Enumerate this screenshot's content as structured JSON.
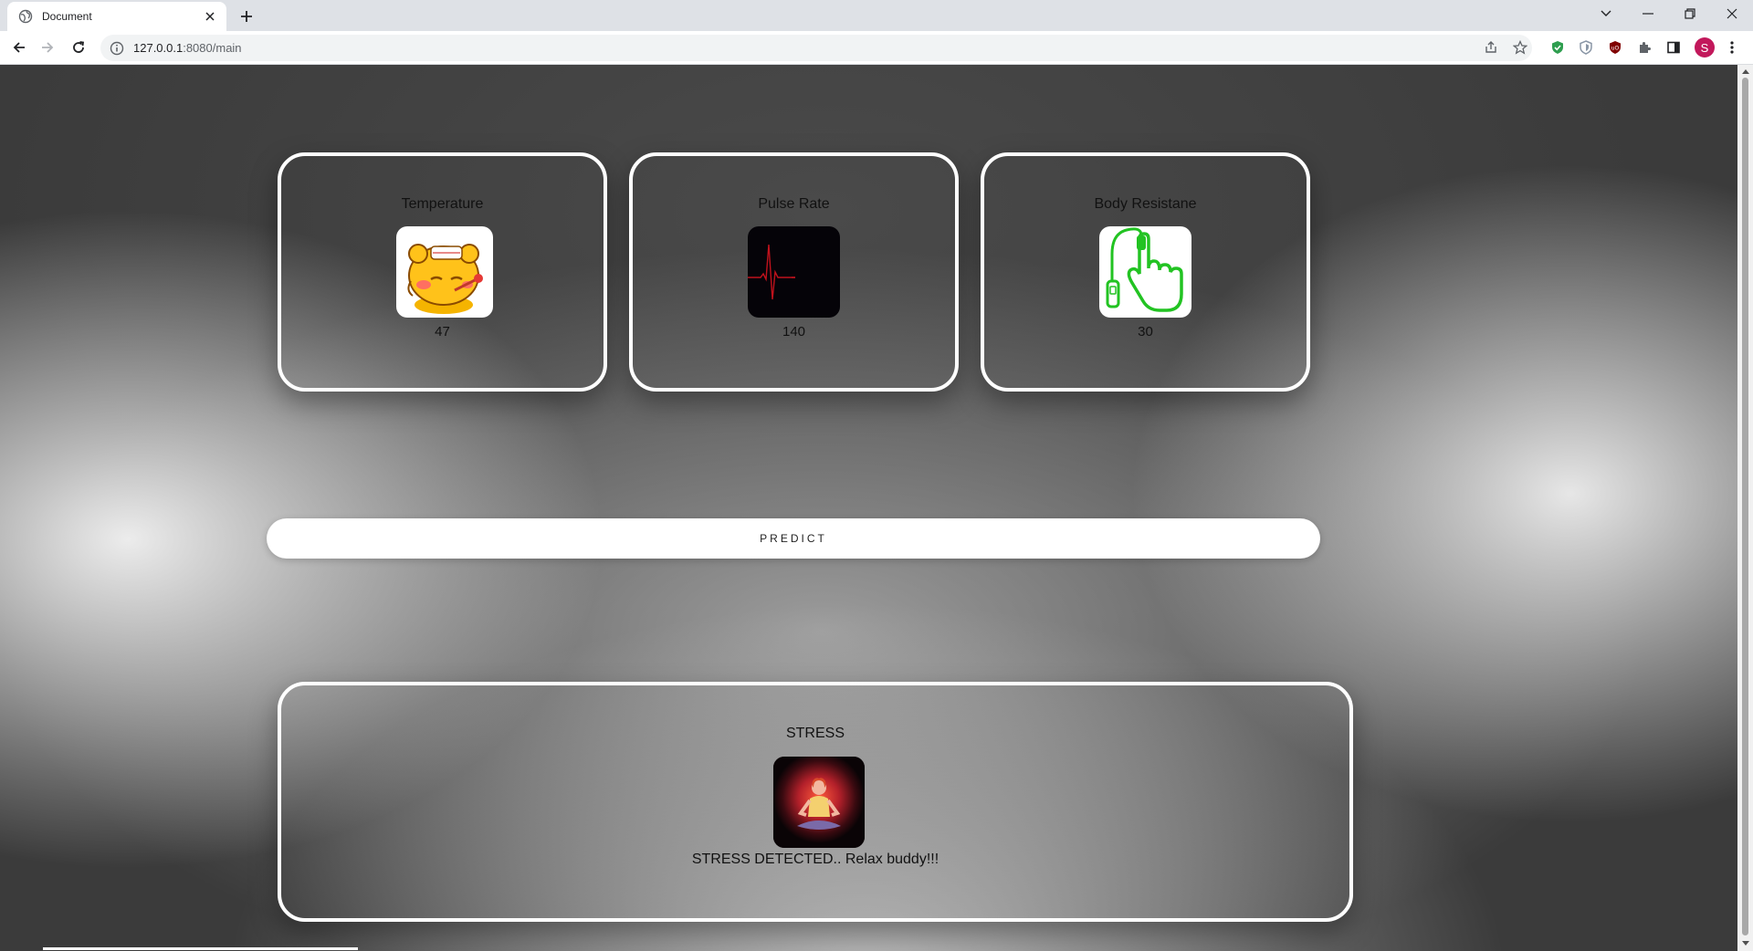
{
  "browser": {
    "tab_title": "Document",
    "url_host": "127.0.0.1",
    "url_path": ":8080/main",
    "avatar_letter": "S"
  },
  "cards": {
    "temperature": {
      "label": "Temperature",
      "value": "47",
      "icon": "sick-bear-thermometer-icon"
    },
    "pulse": {
      "label": "Pulse Rate",
      "value": "140",
      "icon": "heartbeat-ecg-icon"
    },
    "resistance": {
      "label": "Body Resistane",
      "value": "30",
      "icon": "finger-sensor-icon"
    }
  },
  "predict": {
    "label": "PREDICT"
  },
  "result": {
    "label": "STRESS",
    "message": "STRESS DETECTED.. Relax buddy!!!",
    "icon": "meditation-icon"
  },
  "colors": {
    "sensor_green": "#22c322",
    "ecg_red": "#c0121c",
    "avatar": "#c2185b"
  }
}
